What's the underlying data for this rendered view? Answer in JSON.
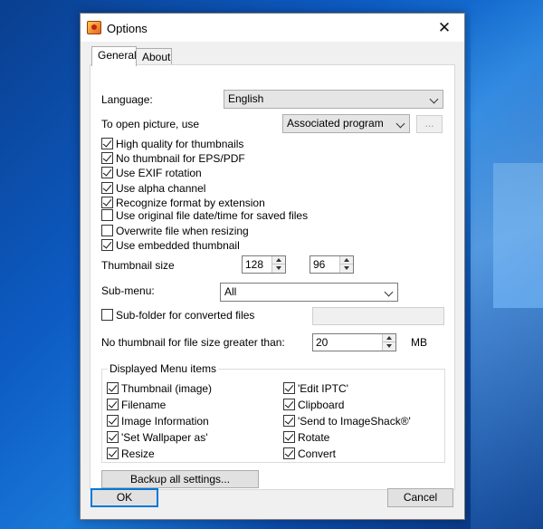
{
  "window": {
    "title": "Options",
    "close_glyph": "✕"
  },
  "tabs": [
    {
      "label": "General"
    },
    {
      "label": "About"
    }
  ],
  "general": {
    "language_label": "Language:",
    "language_value": "English",
    "open_picture_label": "To open picture, use",
    "open_picture_value": "Associated program",
    "browse_label": "...",
    "checkboxes": [
      {
        "label": "High quality for thumbnails",
        "checked": true
      },
      {
        "label": "No thumbnail for EPS/PDF",
        "checked": true
      },
      {
        "label": "Use EXIF rotation",
        "checked": true
      },
      {
        "label": "Use alpha channel",
        "checked": true
      },
      {
        "label": "Recognize format by extension",
        "checked": true
      },
      {
        "label": "Use original file date/time for saved files",
        "checked": false
      },
      {
        "label": "Overwrite file when resizing",
        "checked": false
      },
      {
        "label": "Use embedded thumbnail",
        "checked": true
      }
    ],
    "thumbnail_size_label": "Thumbnail size",
    "thumbnail_width": "128",
    "thumbnail_height": "96",
    "submenu_label": "Sub-menu:",
    "submenu_value": "All",
    "subfolder_label": "Sub-folder for converted files",
    "subfolder_checked": false,
    "subfolder_value": "",
    "no_thumb_size_label": "No thumbnail for file size greater than:",
    "no_thumb_size_value": "20",
    "no_thumb_size_unit": "MB",
    "menu_group_title": "Displayed Menu items",
    "menu_items_left": [
      {
        "label": "Thumbnail (image)",
        "checked": true
      },
      {
        "label": "Filename",
        "checked": true
      },
      {
        "label": "Image Information",
        "checked": true
      },
      {
        "label": "'Set Wallpaper as'",
        "checked": true
      },
      {
        "label": "Resize",
        "checked": true
      }
    ],
    "menu_items_right": [
      {
        "label": "'Edit IPTC'",
        "checked": true
      },
      {
        "label": "Clipboard",
        "checked": true
      },
      {
        "label": "'Send to ImageShack®'",
        "checked": true
      },
      {
        "label": "Rotate",
        "checked": true
      },
      {
        "label": "Convert",
        "checked": true
      }
    ],
    "backup_label": "Backup all settings..."
  },
  "footer": {
    "ok_label": "OK",
    "cancel_label": "Cancel"
  },
  "colors": {
    "accent": "#0078d7",
    "dialog_bg": "#f0f0f0",
    "panel_bg": "#ffffff"
  },
  "icons": {
    "app": "app-icon",
    "close": "close-icon",
    "dropdown": "chevron-down-icon",
    "checkmark": "checkmark-icon"
  }
}
